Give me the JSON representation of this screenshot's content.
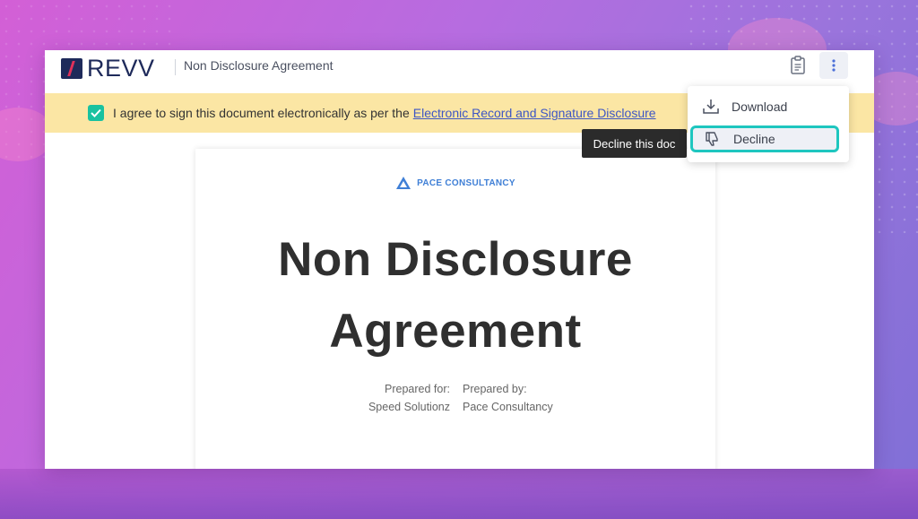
{
  "app": {
    "brand": "REVV",
    "document_title": "Non Disclosure Agreement"
  },
  "consent": {
    "checked": true,
    "text": "I agree to sign this document electronically as per the",
    "link_text": "Electronic Record and Signature Disclosure"
  },
  "document": {
    "company": "PACE CONSULTANCY",
    "heading": "Non Disclosure Agreement",
    "prepared_for_label": "Prepared for:",
    "prepared_for_value": "Speed Solutionz",
    "prepared_by_label": "Prepared by:",
    "prepared_by_value": "Pace Consultancy"
  },
  "menu": {
    "items": [
      {
        "label": "Download",
        "icon": "download-icon"
      },
      {
        "label": "Decline",
        "icon": "thumbs-down-icon",
        "highlighted": true
      }
    ]
  },
  "tooltip": {
    "text": "Decline this doc"
  },
  "colors": {
    "accent": "#1ec6bf",
    "brand": "#1e2a5a",
    "banner": "#fbe6a4",
    "checkbox": "#19c2a0",
    "link": "#3d56c4"
  }
}
